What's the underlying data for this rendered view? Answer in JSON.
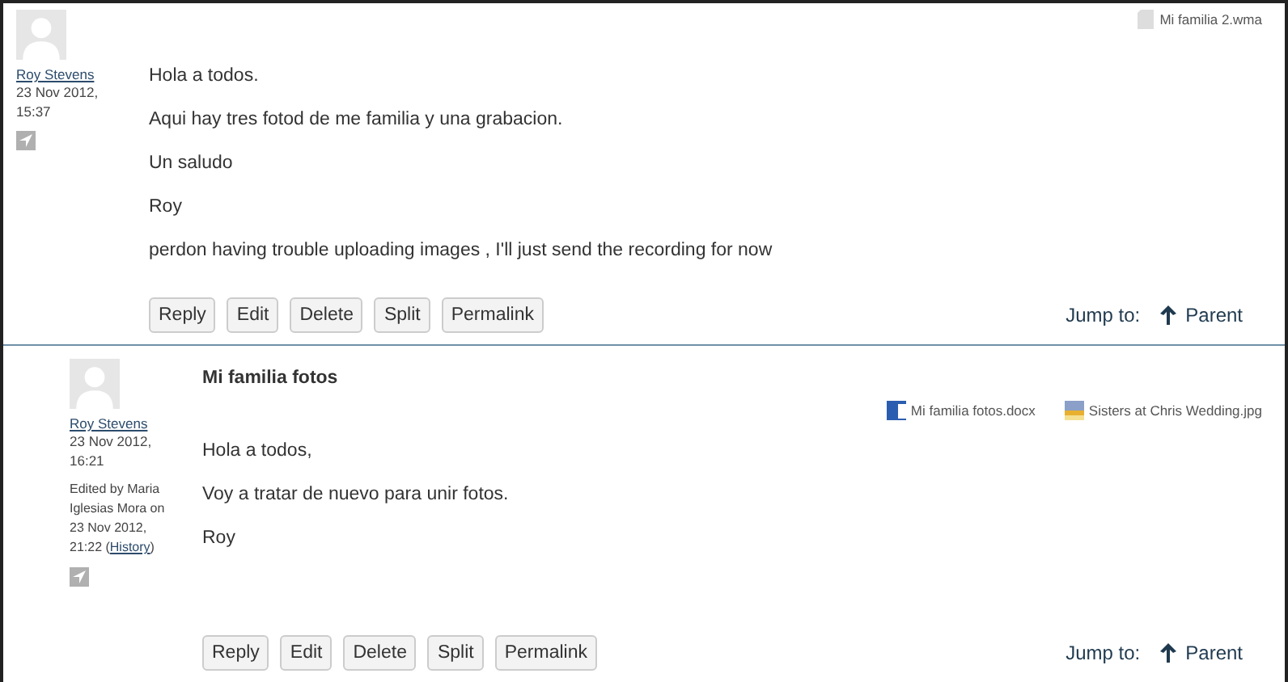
{
  "posts": [
    {
      "author": "Roy Stevens",
      "date": "23 Nov 2012, 15:37",
      "attachments": [
        {
          "kind": "file",
          "name": "Mi familia 2.wma"
        }
      ],
      "paragraphs": [
        "Hola a todos.",
        "Aqui hay tres fotod de me familia y una grabacion.",
        "Un saludo",
        "Roy",
        "perdon having trouble uploading images , I'll just send the recording for now"
      ],
      "buttons": [
        "Reply",
        "Edit",
        "Delete",
        "Split",
        "Permalink"
      ],
      "jump_label": "Jump to:",
      "jump_link": "Parent"
    },
    {
      "author": "Roy Stevens",
      "date": "23 Nov 2012, 16:21",
      "edited": {
        "text": "Edited by Maria Iglesias Mora on 23 Nov 2012, 21:22 (",
        "link": "History",
        "after": ")"
      },
      "title": "Mi familia fotos",
      "attachments": [
        {
          "kind": "word",
          "name": "Mi familia fotos.docx"
        },
        {
          "kind": "image",
          "name": "Sisters at Chris Wedding.jpg"
        }
      ],
      "paragraphs": [
        "Hola a todos,",
        "Voy a tratar de nuevo para unir fotos.",
        "Roy"
      ],
      "buttons": [
        "Reply",
        "Edit",
        "Delete",
        "Split",
        "Permalink"
      ],
      "jump_label": "Jump to:",
      "jump_link": "Parent"
    }
  ]
}
